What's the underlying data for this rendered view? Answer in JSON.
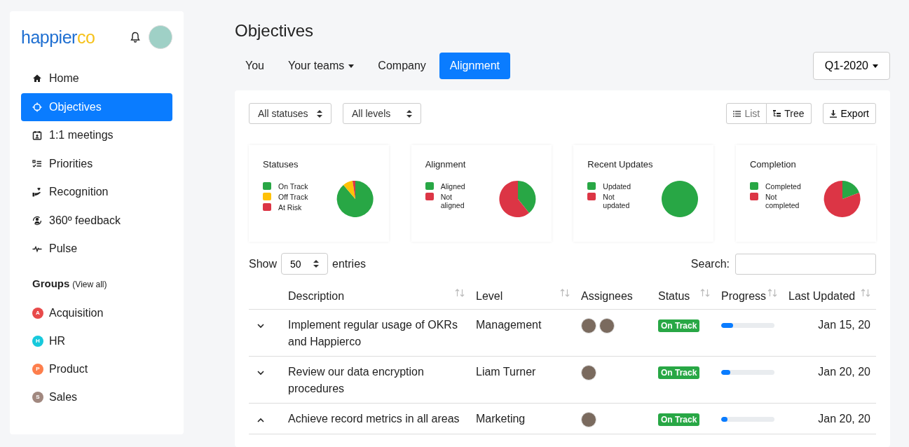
{
  "sidebar": {
    "logo": {
      "text": "happier",
      "accent": "co"
    },
    "nav": [
      {
        "label": "Home",
        "selected": false
      },
      {
        "label": "Objectives",
        "selected": true
      },
      {
        "label": "1:1 meetings",
        "selected": false
      },
      {
        "label": "Priorities",
        "selected": false
      },
      {
        "label": "Recognition",
        "selected": false
      },
      {
        "label": "360º feedback",
        "selected": false
      },
      {
        "label": "Pulse",
        "selected": false
      }
    ],
    "groups_title": "Groups",
    "groups_link": "(View all)",
    "groups": [
      {
        "initial": "A",
        "label": "Acquisition",
        "color": "#e84a4a"
      },
      {
        "initial": "H",
        "label": "HR",
        "color": "#17c9dc"
      },
      {
        "initial": "P",
        "label": "Product",
        "color": "#fd7e4c"
      },
      {
        "initial": "S",
        "label": "Sales",
        "color": "#a1887f"
      }
    ]
  },
  "page_title": "Objectives",
  "tabs": [
    {
      "label": "You",
      "dropdown": false,
      "selected": false
    },
    {
      "label": "Your teams",
      "dropdown": true,
      "selected": false
    },
    {
      "label": "Company",
      "dropdown": false,
      "selected": false
    },
    {
      "label": "Alignment",
      "dropdown": false,
      "selected": true
    }
  ],
  "period": "Q1-2020",
  "filters": [
    "All statuses",
    "All levels"
  ],
  "views": [
    {
      "label": "List",
      "selected": false
    },
    {
      "label": "Tree",
      "selected": true
    }
  ],
  "export": "Export",
  "cards": [
    {
      "title": "Statuses",
      "legend": [
        {
          "label": "On Track",
          "color": "#28a745"
        },
        {
          "label": "Off Track",
          "color": "#ffc107"
        },
        {
          "label": "At Risk",
          "color": "#dc3545"
        }
      ]
    },
    {
      "title": "Alignment",
      "legend": [
        {
          "label": "Aligned",
          "color": "#28a745"
        },
        {
          "label": "Not aligned",
          "color": "#dc3545"
        }
      ]
    },
    {
      "title": "Recent Updates",
      "legend": [
        {
          "label": "Updated",
          "color": "#28a745"
        },
        {
          "label": "Not updated",
          "color": "#dc3545"
        }
      ]
    },
    {
      "title": "Completion",
      "legend": [
        {
          "label": "Completed",
          "color": "#28a745"
        },
        {
          "label": "Not completed",
          "color": "#dc3545"
        }
      ]
    }
  ],
  "show_label": "Show",
  "entries_value": "50",
  "entries_label": "entries",
  "search_label": "Search:",
  "table": {
    "columns": [
      "Description",
      "Level",
      "Assignees",
      "Status",
      "Progress",
      "Last Updated"
    ],
    "rows": [
      {
        "expanded": false,
        "description": "Implement regular usage of OKRs and Happierco",
        "level_name": "Management",
        "status": "On Track",
        "level": 0.23,
        "updated": "Jan 15, 20"
      },
      {
        "expanded": false,
        "description": "Review our data encryption procedures",
        "level_name": "Liam Turner",
        "status": "On Track",
        "level": 0.17,
        "updated": "Jan 20, 20"
      },
      {
        "expanded": true,
        "description": "Achieve record metrics in all areas",
        "level_name": "Marketing",
        "status": "On Track",
        "level": 0.12,
        "updated": "Jan 20, 20"
      }
    ]
  }
}
